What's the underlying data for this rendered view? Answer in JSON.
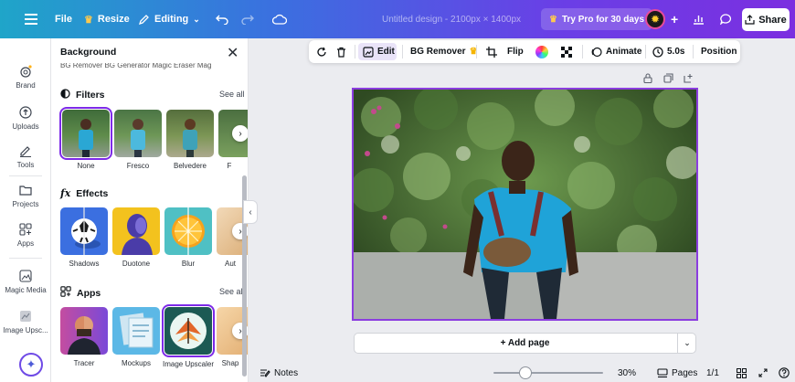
{
  "topbar": {
    "file_label": "File",
    "resize_label": "Resize",
    "editing_label": "Editing",
    "doc_title": "Untitled design - 2100px × 1400px",
    "pro_label": "Try Pro for 30 days",
    "share_label": "Share"
  },
  "rail": {
    "items": [
      {
        "label": "Brand",
        "icon": "brand-icon"
      },
      {
        "label": "Uploads",
        "icon": "upload-cloud-icon"
      },
      {
        "label": "Tools",
        "icon": "pen-tool-icon"
      },
      {
        "label": "Projects",
        "icon": "folder-icon"
      },
      {
        "label": "Apps",
        "icon": "apps-grid-icon"
      },
      {
        "label": "Magic Media",
        "icon": "magic-media-icon"
      },
      {
        "label": "Image Upsc...",
        "icon": "image-upscaler-icon"
      }
    ]
  },
  "panel": {
    "title": "Background",
    "cut_off_row": "BG Remover    BG Generator    Magic Eraser    Mag",
    "filters": {
      "heading": "Filters",
      "see_all": "See all",
      "items": [
        {
          "label": "None"
        },
        {
          "label": "Fresco"
        },
        {
          "label": "Belvedere"
        },
        {
          "label": "F"
        }
      ]
    },
    "effects": {
      "heading": "Effects",
      "items": [
        {
          "label": "Shadows"
        },
        {
          "label": "Duotone"
        },
        {
          "label": "Blur"
        },
        {
          "label": "Aut"
        }
      ]
    },
    "apps": {
      "heading": "Apps",
      "see_all": "See all",
      "items": [
        {
          "label": "Tracer"
        },
        {
          "label": "Mockups"
        },
        {
          "label": "Image Upscaler"
        },
        {
          "label": "Shap"
        }
      ]
    }
  },
  "context_toolbar": {
    "edit_label": "Edit",
    "bg_remover_label": "BG Remover",
    "flip_label": "Flip",
    "animate_label": "Animate",
    "duration_label": "5.0s",
    "position_label": "Position"
  },
  "canvas": {
    "add_page_label": "+ Add page"
  },
  "bottombar": {
    "notes_label": "Notes",
    "zoom_label": "30%",
    "pages_label": "Pages",
    "page_count": "1/1"
  },
  "colors": {
    "accent": "#7d2ae8",
    "gradient_start": "#1fa5c9",
    "gradient_end": "#7b2fe0"
  }
}
